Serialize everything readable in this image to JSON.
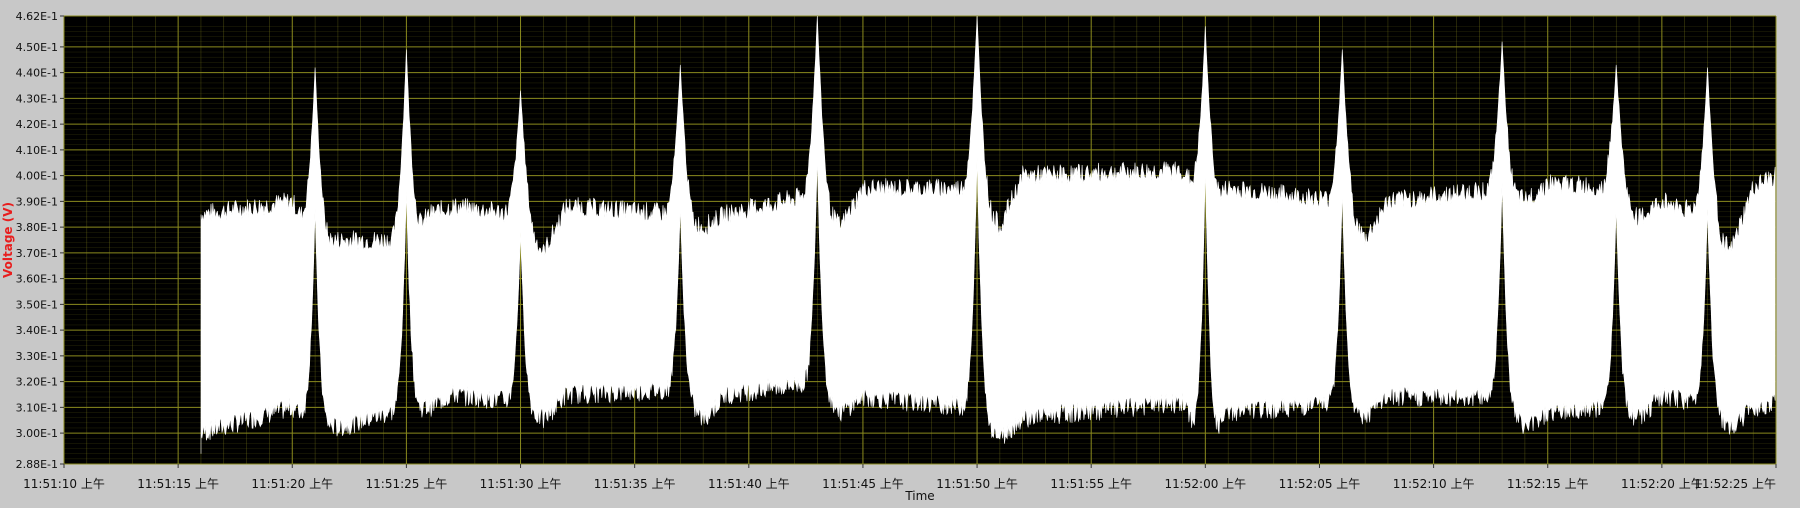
{
  "chart_data": {
    "type": "line",
    "title": "",
    "xlabel": "Time",
    "ylabel": "Voltage (V)",
    "x_tick_labels": [
      "11:51:10 上午",
      "11:51:15 上午",
      "11:51:20 上午",
      "11:51:25 上午",
      "11:51:30 上午",
      "11:51:35 上午",
      "11:51:40 上午",
      "11:51:45 上午",
      "11:51:50 上午",
      "11:51:55 上午",
      "11:52:00 上午",
      "11:52:05 上午",
      "11:52:10 上午",
      "11:52:15 上午",
      "11:52:20 上午",
      "11:52:25 上午"
    ],
    "y_tick_labels": [
      "2.88E-1",
      "3.00E-1",
      "3.10E-1",
      "3.20E-1",
      "3.30E-1",
      "3.40E-1",
      "3.50E-1",
      "3.60E-1",
      "3.70E-1",
      "3.80E-1",
      "3.90E-1",
      "4.00E-1",
      "4.10E-1",
      "4.20E-1",
      "4.30E-1",
      "4.40E-1",
      "4.50E-1",
      "4.62E-1"
    ],
    "y_tick_values": [
      0.288,
      0.3,
      0.31,
      0.32,
      0.33,
      0.34,
      0.35,
      0.36,
      0.37,
      0.38,
      0.39,
      0.4,
      0.41,
      0.42,
      0.43,
      0.44,
      0.45,
      0.462
    ],
    "x_range": [
      "11:51:10",
      "11:52:25"
    ],
    "ylim": [
      0.288,
      0.462
    ],
    "grid": true,
    "series": [
      {
        "signal_start": "11:51:16",
        "envelope_x": [
          "11:51:16",
          "11:51:20",
          "11:51:21",
          "11:51:22",
          "11:51:25",
          "11:51:26",
          "11:51:27",
          "11:51:30",
          "11:51:31",
          "11:51:32",
          "11:51:37",
          "11:51:38",
          "11:51:39",
          "11:51:43",
          "11:51:44",
          "11:51:45",
          "11:51:50",
          "11:51:51",
          "11:51:52",
          "11:51:59",
          "11:52:00",
          "11:52:01",
          "11:52:06",
          "11:52:07",
          "11:52:08",
          "11:52:13",
          "11:52:14",
          "11:52:15",
          "11:52:18",
          "11:52:19",
          "11:52:20",
          "11:52:22",
          "11:52:23",
          "11:52:24",
          "11:52:25"
        ],
        "envelope_max": [
          0.385,
          0.39,
          0.375,
          0.375,
          0.375,
          0.385,
          0.388,
          0.385,
          0.37,
          0.388,
          0.385,
          0.38,
          0.385,
          0.393,
          0.38,
          0.395,
          0.395,
          0.38,
          0.4,
          0.402,
          0.39,
          0.395,
          0.39,
          0.375,
          0.39,
          0.395,
          0.39,
          0.397,
          0.395,
          0.383,
          0.39,
          0.385,
          0.37,
          0.395,
          0.4
        ],
        "envelope_min": [
          0.3,
          0.31,
          0.305,
          0.302,
          0.31,
          0.31,
          0.315,
          0.312,
          0.305,
          0.315,
          0.317,
          0.305,
          0.315,
          0.32,
          0.308,
          0.314,
          0.31,
          0.298,
          0.306,
          0.312,
          0.295,
          0.308,
          0.312,
          0.306,
          0.314,
          0.314,
          0.302,
          0.308,
          0.31,
          0.306,
          0.314,
          0.312,
          0.302,
          0.31,
          0.312
        ],
        "spike_times": [
          "11:51:21",
          "11:51:25",
          "11:51:30",
          "11:51:37",
          "11:51:43",
          "11:51:50",
          "11:52:00",
          "11:52:06",
          "11:52:13",
          "11:52:18",
          "11:52:22"
        ],
        "spike_peaks": [
          0.442,
          0.449,
          0.433,
          0.443,
          0.462,
          0.462,
          0.458,
          0.449,
          0.452,
          0.443,
          0.442
        ]
      }
    ],
    "colors": {
      "frame": "#c8c8c8",
      "plot_background": "#000000",
      "grid": "#8a8a1e",
      "trace": "#ffffff",
      "ylabel": "#e81e1e",
      "tick_text": "#111111"
    }
  }
}
